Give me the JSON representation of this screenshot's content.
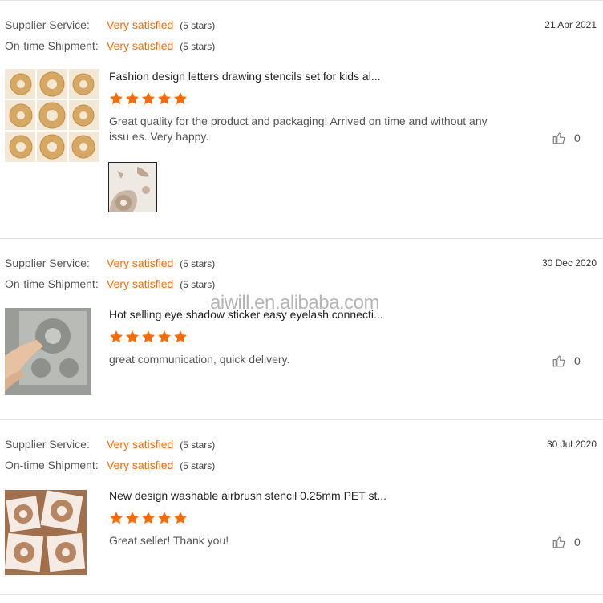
{
  "reviews": [
    {
      "supplier_label": "Supplier Service:",
      "supplier_value": "Very satisfied",
      "supplier_stars": "(5 stars)",
      "shipment_label": "On-time Shipment:",
      "shipment_value": "Very satisfied",
      "shipment_stars": "(5 stars)",
      "date": "21 Apr 2021",
      "product_title": "Fashion design letters drawing stencils set for kids al...",
      "rating": 5,
      "text": "Great quality for the product and packaging! Arrived on time and without any issu es. Very happy.",
      "helpful_count": "0"
    },
    {
      "supplier_label": "Supplier Service:",
      "supplier_value": "Very satisfied",
      "supplier_stars": "(5 stars)",
      "shipment_label": "On-time Shipment:",
      "shipment_value": "Very satisfied",
      "shipment_stars": "(5 stars)",
      "date": "30 Dec 2020",
      "product_title": "Hot selling eye shadow sticker easy eyelash connecti...",
      "rating": 5,
      "text": "great communication, quick delivery.",
      "helpful_count": "0"
    },
    {
      "supplier_label": "Supplier Service:",
      "supplier_value": "Very satisfied",
      "supplier_stars": "(5 stars)",
      "shipment_label": "On-time Shipment:",
      "shipment_value": "Very satisfied",
      "shipment_stars": "(5 stars)",
      "date": "30 Jul 2020",
      "product_title": "New design washable airbrush stencil 0.25mm PET st...",
      "rating": 5,
      "text": "Great seller! Thank you!",
      "helpful_count": "0"
    }
  ],
  "watermark": "aiwill.en.alibaba.com",
  "colors": {
    "accent": "#ff6a00",
    "divider": "#e3e3e3"
  },
  "icons": {
    "star": "star-icon",
    "helpful": "thumbs-up-icon"
  }
}
